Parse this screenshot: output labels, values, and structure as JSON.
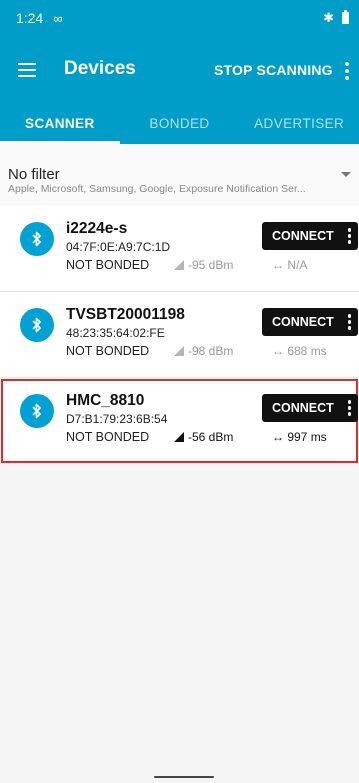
{
  "status_bar": {
    "time": "1:24"
  },
  "app_bar": {
    "title": "Devices",
    "stop_label": "STOP SCANNING"
  },
  "tabs": [
    {
      "label": "SCANNER",
      "active": true
    },
    {
      "label": "BONDED",
      "active": false
    },
    {
      "label": "ADVERTISER",
      "active": false
    }
  ],
  "filter": {
    "title": "No filter",
    "subtitle": "Apple, Microsoft, Samsung, Google, Exposure Notification Ser..."
  },
  "devices": [
    {
      "name": "i2224e-s",
      "mac": "04:7F:0E:A9:7C:1D",
      "bond": "NOT BONDED",
      "rssi": "-95 dBm",
      "interval": "↔ N/A",
      "connect": "CONNECT"
    },
    {
      "name": "TVSBT20001198",
      "mac": "48:23:35:64:02:FE",
      "bond": "NOT BONDED",
      "rssi": "-98 dBm",
      "interval": "↔ 688 ms",
      "connect": "CONNECT"
    },
    {
      "name": "HMC_8810",
      "mac": "D7:B1:79:23:6B:54",
      "bond": "NOT BONDED",
      "rssi": "-56 dBm",
      "interval": "↔ 997 ms",
      "connect": "CONNECT"
    }
  ],
  "colors": {
    "primary": "#009dc8",
    "avatar": "#00a2d3",
    "highlight": "#e12b2b"
  }
}
